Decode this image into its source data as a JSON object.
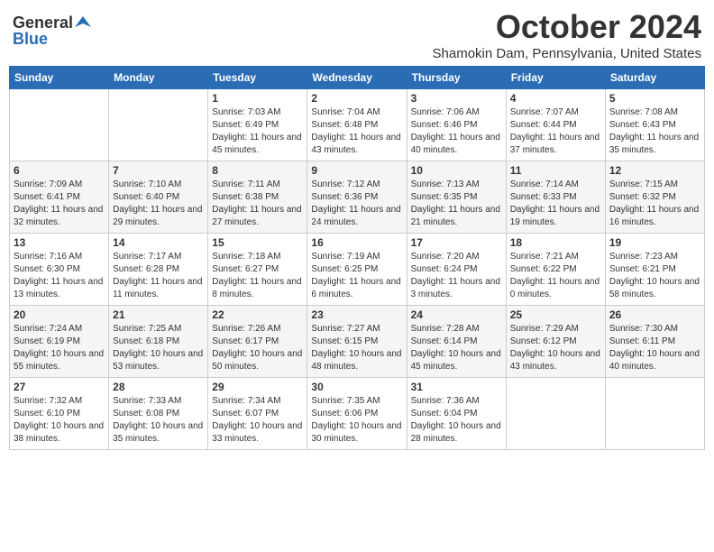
{
  "header": {
    "logo_general": "General",
    "logo_blue": "Blue",
    "month": "October 2024",
    "location": "Shamokin Dam, Pennsylvania, United States"
  },
  "days_of_week": [
    "Sunday",
    "Monday",
    "Tuesday",
    "Wednesday",
    "Thursday",
    "Friday",
    "Saturday"
  ],
  "weeks": [
    [
      {
        "day": "",
        "info": ""
      },
      {
        "day": "",
        "info": ""
      },
      {
        "day": "1",
        "info": "Sunrise: 7:03 AM\nSunset: 6:49 PM\nDaylight: 11 hours and 45 minutes."
      },
      {
        "day": "2",
        "info": "Sunrise: 7:04 AM\nSunset: 6:48 PM\nDaylight: 11 hours and 43 minutes."
      },
      {
        "day": "3",
        "info": "Sunrise: 7:06 AM\nSunset: 6:46 PM\nDaylight: 11 hours and 40 minutes."
      },
      {
        "day": "4",
        "info": "Sunrise: 7:07 AM\nSunset: 6:44 PM\nDaylight: 11 hours and 37 minutes."
      },
      {
        "day": "5",
        "info": "Sunrise: 7:08 AM\nSunset: 6:43 PM\nDaylight: 11 hours and 35 minutes."
      }
    ],
    [
      {
        "day": "6",
        "info": "Sunrise: 7:09 AM\nSunset: 6:41 PM\nDaylight: 11 hours and 32 minutes."
      },
      {
        "day": "7",
        "info": "Sunrise: 7:10 AM\nSunset: 6:40 PM\nDaylight: 11 hours and 29 minutes."
      },
      {
        "day": "8",
        "info": "Sunrise: 7:11 AM\nSunset: 6:38 PM\nDaylight: 11 hours and 27 minutes."
      },
      {
        "day": "9",
        "info": "Sunrise: 7:12 AM\nSunset: 6:36 PM\nDaylight: 11 hours and 24 minutes."
      },
      {
        "day": "10",
        "info": "Sunrise: 7:13 AM\nSunset: 6:35 PM\nDaylight: 11 hours and 21 minutes."
      },
      {
        "day": "11",
        "info": "Sunrise: 7:14 AM\nSunset: 6:33 PM\nDaylight: 11 hours and 19 minutes."
      },
      {
        "day": "12",
        "info": "Sunrise: 7:15 AM\nSunset: 6:32 PM\nDaylight: 11 hours and 16 minutes."
      }
    ],
    [
      {
        "day": "13",
        "info": "Sunrise: 7:16 AM\nSunset: 6:30 PM\nDaylight: 11 hours and 13 minutes."
      },
      {
        "day": "14",
        "info": "Sunrise: 7:17 AM\nSunset: 6:28 PM\nDaylight: 11 hours and 11 minutes."
      },
      {
        "day": "15",
        "info": "Sunrise: 7:18 AM\nSunset: 6:27 PM\nDaylight: 11 hours and 8 minutes."
      },
      {
        "day": "16",
        "info": "Sunrise: 7:19 AM\nSunset: 6:25 PM\nDaylight: 11 hours and 6 minutes."
      },
      {
        "day": "17",
        "info": "Sunrise: 7:20 AM\nSunset: 6:24 PM\nDaylight: 11 hours and 3 minutes."
      },
      {
        "day": "18",
        "info": "Sunrise: 7:21 AM\nSunset: 6:22 PM\nDaylight: 11 hours and 0 minutes."
      },
      {
        "day": "19",
        "info": "Sunrise: 7:23 AM\nSunset: 6:21 PM\nDaylight: 10 hours and 58 minutes."
      }
    ],
    [
      {
        "day": "20",
        "info": "Sunrise: 7:24 AM\nSunset: 6:19 PM\nDaylight: 10 hours and 55 minutes."
      },
      {
        "day": "21",
        "info": "Sunrise: 7:25 AM\nSunset: 6:18 PM\nDaylight: 10 hours and 53 minutes."
      },
      {
        "day": "22",
        "info": "Sunrise: 7:26 AM\nSunset: 6:17 PM\nDaylight: 10 hours and 50 minutes."
      },
      {
        "day": "23",
        "info": "Sunrise: 7:27 AM\nSunset: 6:15 PM\nDaylight: 10 hours and 48 minutes."
      },
      {
        "day": "24",
        "info": "Sunrise: 7:28 AM\nSunset: 6:14 PM\nDaylight: 10 hours and 45 minutes."
      },
      {
        "day": "25",
        "info": "Sunrise: 7:29 AM\nSunset: 6:12 PM\nDaylight: 10 hours and 43 minutes."
      },
      {
        "day": "26",
        "info": "Sunrise: 7:30 AM\nSunset: 6:11 PM\nDaylight: 10 hours and 40 minutes."
      }
    ],
    [
      {
        "day": "27",
        "info": "Sunrise: 7:32 AM\nSunset: 6:10 PM\nDaylight: 10 hours and 38 minutes."
      },
      {
        "day": "28",
        "info": "Sunrise: 7:33 AM\nSunset: 6:08 PM\nDaylight: 10 hours and 35 minutes."
      },
      {
        "day": "29",
        "info": "Sunrise: 7:34 AM\nSunset: 6:07 PM\nDaylight: 10 hours and 33 minutes."
      },
      {
        "day": "30",
        "info": "Sunrise: 7:35 AM\nSunset: 6:06 PM\nDaylight: 10 hours and 30 minutes."
      },
      {
        "day": "31",
        "info": "Sunrise: 7:36 AM\nSunset: 6:04 PM\nDaylight: 10 hours and 28 minutes."
      },
      {
        "day": "",
        "info": ""
      },
      {
        "day": "",
        "info": ""
      }
    ]
  ]
}
